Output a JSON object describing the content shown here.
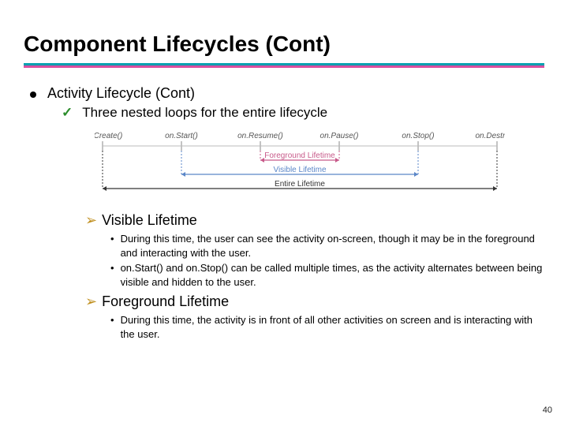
{
  "title": "Component Lifecycles (Cont)",
  "bullet1": "Activity Lifecycle (Cont)",
  "bullet2": "Three nested loops for the entire lifecycle",
  "diagram": {
    "callbacks": [
      "on.Create()",
      "on.Start()",
      "on.Resume()",
      "on.Pause()",
      "on.Stop()",
      "on.Destroy()"
    ],
    "spans": [
      {
        "label": "Foreground Lifetime",
        "from": 2,
        "to": 3,
        "color": "#c85a8a"
      },
      {
        "label": "Visible Lifetime",
        "from": 1,
        "to": 4,
        "color": "#5a86c8"
      },
      {
        "label": "Entire Lifetime",
        "from": 0,
        "to": 5,
        "color": "#333"
      }
    ]
  },
  "sections": [
    {
      "heading": "Visible Lifetime",
      "points": [
        "During this time, the user can see the activity on-screen, though it may be in the foreground and interacting with the user.",
        "on.Start() and on.Stop() can be called multiple times, as the activity alternates between being visible and hidden to the user."
      ]
    },
    {
      "heading": "Foreground Lifetime",
      "points": [
        "During this time, the activity is in front of all other activities on screen and is interacting with the user."
      ]
    }
  ],
  "slide_number": "40"
}
